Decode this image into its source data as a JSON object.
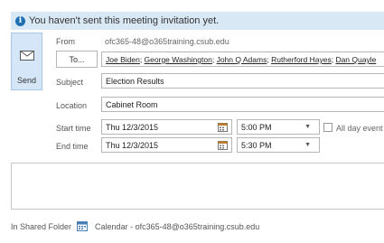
{
  "infobar": {
    "message": "You haven't sent this meeting invitation yet.",
    "icon": "info-icon"
  },
  "send": {
    "label": "Send",
    "icon": "envelope-icon"
  },
  "from": {
    "label": "From",
    "value": "ofc365-48@o365training.csub.edu"
  },
  "to": {
    "button_label": "To...",
    "recipients": [
      "Joe Biden",
      "George Washington",
      "John Q Adams",
      "Rutherford Hayes",
      "Dan Quayle"
    ]
  },
  "subject": {
    "label": "Subject",
    "value": "Election Results"
  },
  "location": {
    "label": "Location",
    "value": "Cabinet Room"
  },
  "start": {
    "label": "Start time",
    "date": "Thu 12/3/2015",
    "time": "5:00 PM"
  },
  "end": {
    "label": "End time",
    "date": "Thu 12/3/2015",
    "time": "5:30 PM"
  },
  "all_day": {
    "label": "All day event",
    "checked": false
  },
  "footer": {
    "label": "In Shared Folder",
    "calendar": "Calendar - ofc365-48@o365training.csub.edu"
  },
  "colors": {
    "infobar_bg": "#d9e8f5",
    "info_icon": "#1f6fb2",
    "send_bg": "#d4e6f7"
  }
}
